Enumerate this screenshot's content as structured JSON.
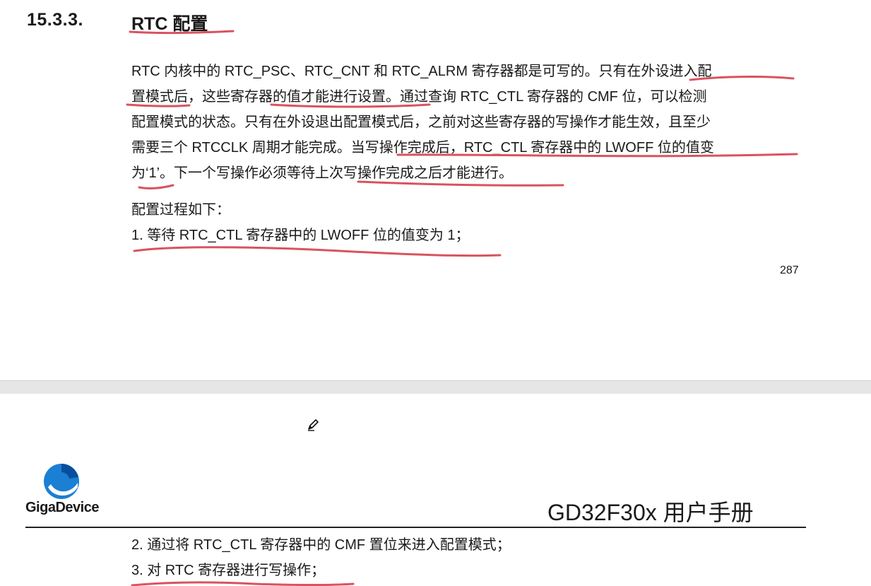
{
  "section": {
    "number": "15.3.3.",
    "title": "RTC  配置"
  },
  "paragraph_lines": [
    "RTC 内核中的 RTC_PSC、RTC_CNT 和 RTC_ALRM 寄存器都是可写的。只有在外设进入配",
    "置模式后，这些寄存器的值才能进行设置。通过查询 RTC_CTL 寄存器的 CMF 位，可以检测",
    "配置模式的状态。只有在外设退出配置模式后，之前对这些寄存器的写操作才能生效，且至少",
    "需要三个 RTCCLK 周期才能完成。当写操作完成后，RTC_CTL 寄存器中的 LWOFF 位的值变",
    "为‘1’。下一个写操作必须等待上次写操作完成之后才能进行。"
  ],
  "procedure_title": "配置过程如下：",
  "steps": [
    "1. 等待 RTC_CTL 寄存器中的 LWOFF  位的值变为 1；",
    "2. 通过将 RTC_CTL 寄存器中的 CMF 置位来进入配置模式；",
    "3. 对 RTC 寄存器进行写操作；"
  ],
  "page_number": "287",
  "header": {
    "logo_text": "GigaDevice",
    "manual_title": "GD32F30x 用户手册"
  },
  "colors": {
    "annotation": "#d9535f",
    "logo_blue": "#1b7fd3",
    "logo_dark": "#0a4f9e"
  },
  "icons": {
    "cursor": "pen-cursor-icon"
  }
}
